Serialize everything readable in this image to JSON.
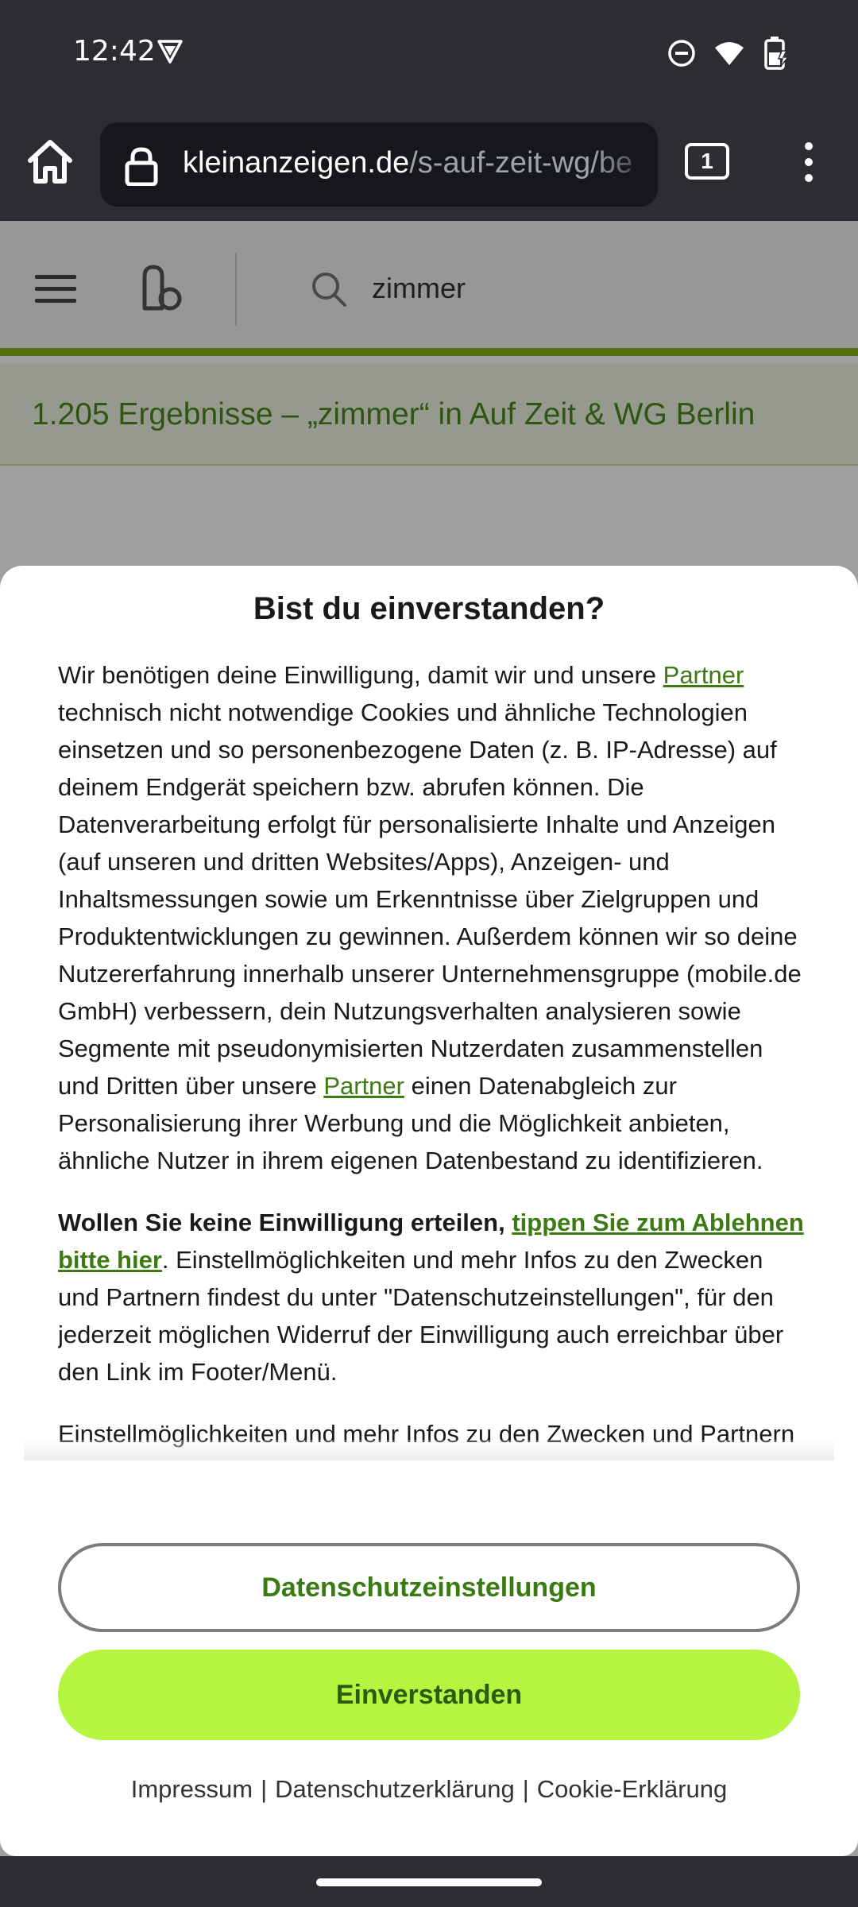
{
  "status_bar": {
    "time": "12:42",
    "icons": [
      "vpn-shield-icon",
      "do-not-disturb-icon",
      "wifi-icon",
      "battery-charging-icon"
    ]
  },
  "browser": {
    "url_domain": "kleinanzeigen.de",
    "url_path": "/s-auf-zeit-wg/be",
    "tab_count": "1"
  },
  "site": {
    "search_query": "zimmer",
    "brand_color": "#86b817",
    "results_heading": "1.205 Ergebnisse – „zimmer“ in Auf Zeit & WG Berlin"
  },
  "consent": {
    "title": "Bist du einverstanden?",
    "p1_part1": "Wir benötigen deine Einwilligung, damit wir und unsere ",
    "partner_link_1": "Partner",
    "p1_part2": " technisch nicht notwendige Cookies und ähnliche Technologien einsetzen und so personenbezogene Daten (z. B. IP-Adresse) auf deinem Endgerät speichern bzw. abrufen können. Die Datenverarbeitung erfolgt für personalisierte Inhalte und Anzeigen (auf unseren und dritten Websites/Apps), Anzeigen- und Inhaltsmessungen sowie um Erkenntnisse über Zielgruppen und Produktentwicklungen zu gewinnen. Außerdem können wir so deine Nutzererfahrung innerhalb unserer Unternehmensgruppe (mobile.de GmbH) verbessern, dein Nutzungsverhalten analysieren sowie Segmente mit pseudonymisierten Nutzerdaten zusammenstellen und Dritten über unsere ",
    "partner_link_2": "Partner",
    "p1_part3": " einen Datenabgleich zur Personalisierung ihrer Werbung und die Möglichkeit anbieten, ähnliche Nutzer in ihrem eigenen Datenbestand zu identifizieren.",
    "p2_bold": "Wollen Sie keine Einwilligung erteilen, ",
    "reject_link": "tippen Sie zum Ablehnen bitte hier",
    "p2_rest": ". Einstellmöglichkeiten und mehr Infos zu den Zwecken und Partnern findest du unter \"Datenschutzeinstellungen\", für den jederzeit möglichen Widerruf der Einwilligung auch erreichbar über den Link im Footer/Menü.",
    "p3": "Einstellmöglichkeiten und mehr Infos zu den Zwecken und Partnern findest du unter \"Datenschutzeinstellungen\", für den jederzeit möglichen Widerruf der Einwilligung auch erreichbar über den Link im Footer/Menü.",
    "settings_button": "Datenschutzeinstellungen",
    "accept_button": "Einverstanden",
    "accept_color": "#b5f542",
    "footer": {
      "impressum": "Impressum",
      "separator": "|",
      "privacy": "Datenschutzerklärung",
      "cookie": "Cookie-Erklärung"
    }
  }
}
